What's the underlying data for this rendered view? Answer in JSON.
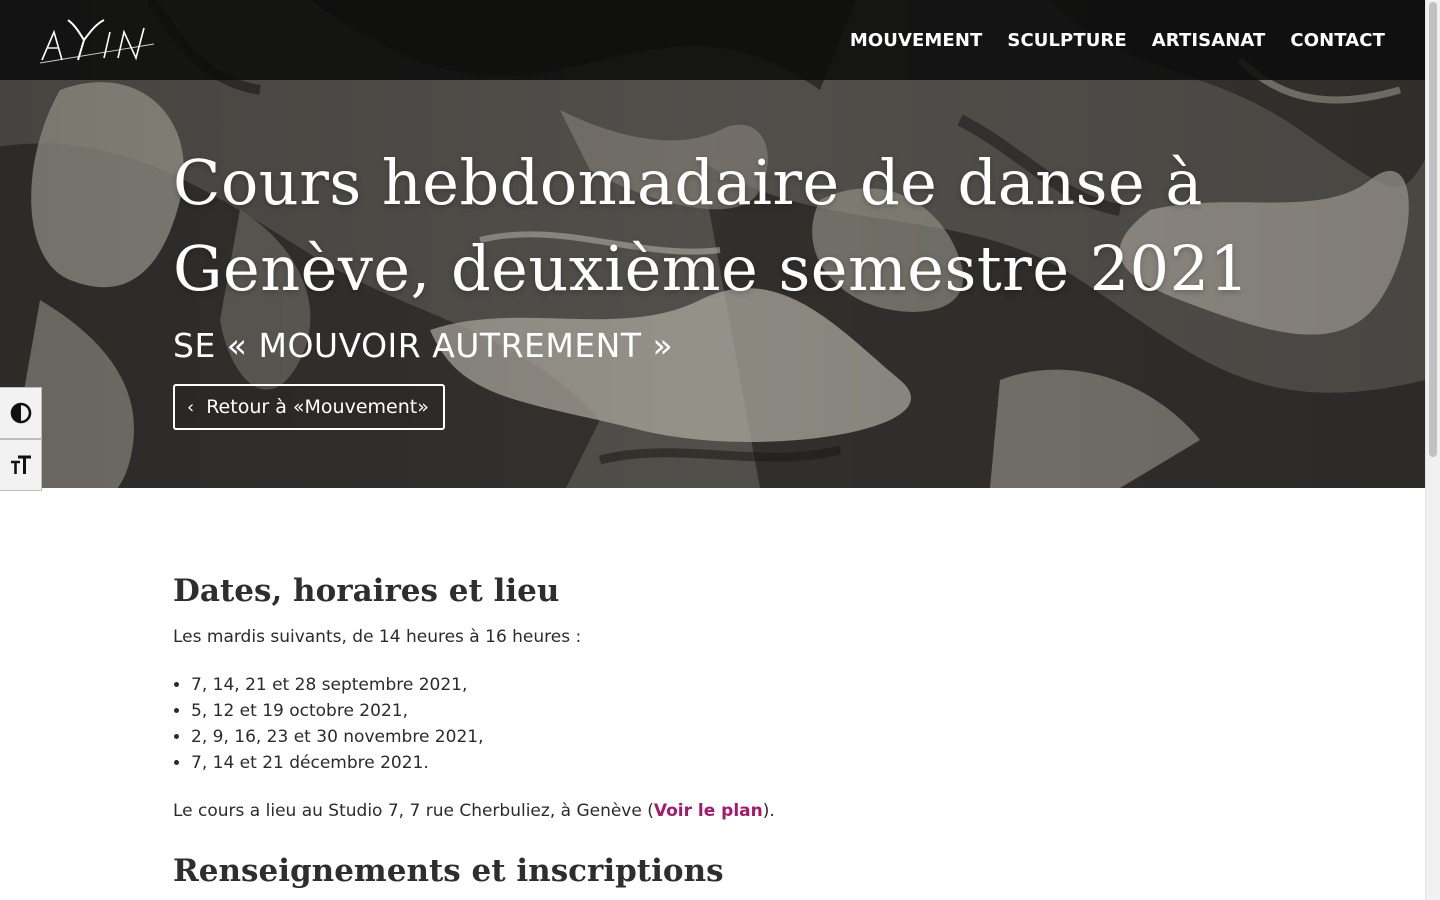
{
  "header": {
    "logo_text": "AYIN",
    "nav": [
      {
        "label": "MOUVEMENT"
      },
      {
        "label": "SCULPTURE"
      },
      {
        "label": "ARTISANAT"
      },
      {
        "label": "CONTACT"
      }
    ]
  },
  "hero": {
    "title": "Cours hebdomadaire de danse à Genève, deuxième semestre 2021",
    "subtitle": "SE « MOUVOIR AUTREMENT »",
    "back_button": {
      "chevron": "‹",
      "label": "Retour à «Mouvement»"
    }
  },
  "accessibility": {
    "contrast_icon": "contrast-icon",
    "font_size_icon": "font-size-icon"
  },
  "content": {
    "section1_heading": "Dates, horaires et lieu",
    "intro": "Les mardis suivants, de 14 heures à 16 heures :",
    "dates": [
      "7, 14, 21 et 28 septembre 2021,",
      "5, 12 et 19 octobre 2021,",
      "2, 9, 16, 23 et 30 novembre 2021,",
      "7, 14 et 21 décembre 2021."
    ],
    "venue_prefix": "Le cours a lieu au Studio 7, 7 rue Cherbuliez, à Genève (",
    "venue_link": "Voir le plan",
    "venue_suffix": ").",
    "section2_heading": "Renseignements et inscriptions"
  },
  "colors": {
    "link": "#a3196b",
    "topbar": "#0c0c0c",
    "hero_base": "#4b4a46"
  }
}
